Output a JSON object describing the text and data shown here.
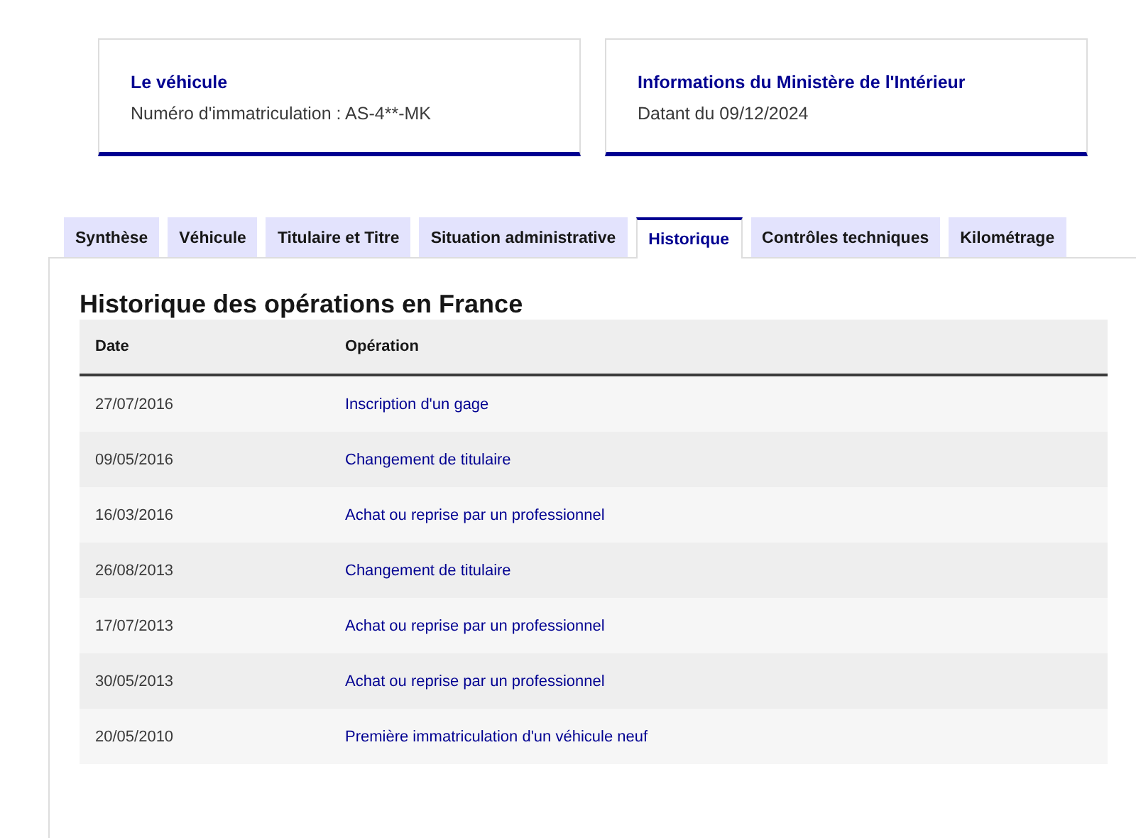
{
  "cards": [
    {
      "title": "Le véhicule",
      "text": "Numéro d'immatriculation : AS-4**-MK"
    },
    {
      "title": "Informations du Ministère de l'Intérieur",
      "text": "Datant du 09/12/2024"
    }
  ],
  "tabs": [
    {
      "label": "Synthèse",
      "selected": false
    },
    {
      "label": "Véhicule",
      "selected": false
    },
    {
      "label": "Titulaire et Titre",
      "selected": false
    },
    {
      "label": "Situation administrative",
      "selected": false
    },
    {
      "label": "Historique",
      "selected": true
    },
    {
      "label": "Contrôles techniques",
      "selected": false
    },
    {
      "label": "Kilométrage",
      "selected": false
    }
  ],
  "section_title": "Historique des opérations en France",
  "table": {
    "columns": [
      "Date",
      "Opération"
    ],
    "rows": [
      [
        "27/07/2016",
        "Inscription d'un gage"
      ],
      [
        "09/05/2016",
        "Changement de titulaire"
      ],
      [
        "16/03/2016",
        "Achat ou reprise par un professionnel"
      ],
      [
        "26/08/2013",
        "Changement de titulaire"
      ],
      [
        "17/07/2013",
        "Achat ou reprise par un professionnel"
      ],
      [
        "30/05/2013",
        "Achat ou reprise par un professionnel"
      ],
      [
        "20/05/2010",
        "Première immatriculation d'un véhicule neuf"
      ]
    ]
  }
}
